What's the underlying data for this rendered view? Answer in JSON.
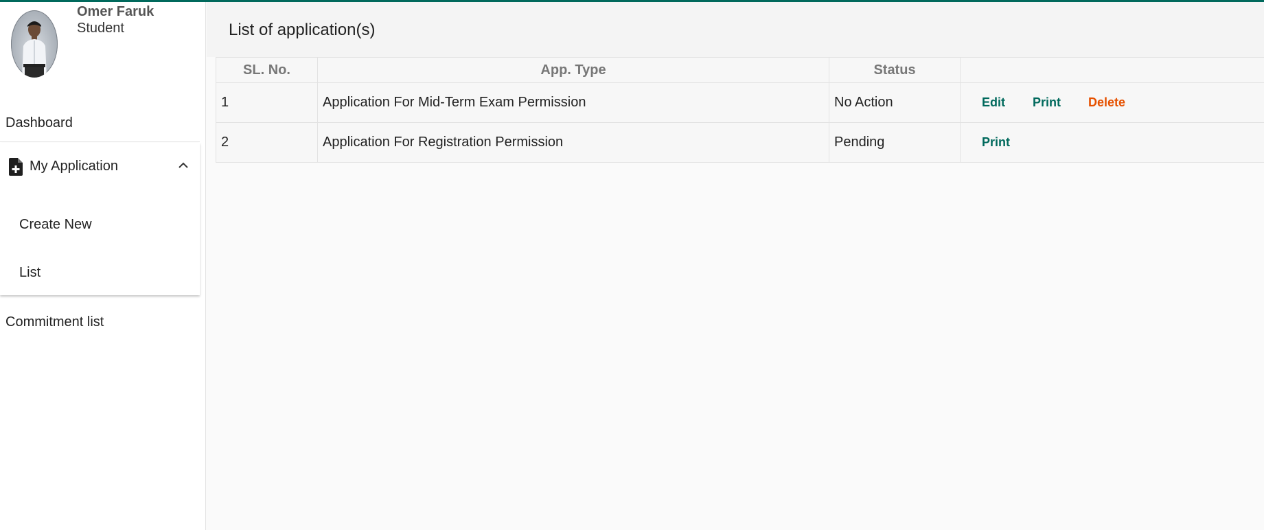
{
  "colors": {
    "accent": "#00695c",
    "danger": "#e65100"
  },
  "user": {
    "name": "Omer Faruk",
    "role": "Student"
  },
  "sidebar": {
    "dashboard": "Dashboard",
    "my_application": {
      "label": "My Application",
      "icon": "file-add-icon",
      "expanded": true,
      "children": [
        "Create New",
        "List"
      ]
    },
    "commitment": "Commitment list"
  },
  "main": {
    "title": "List of application(s)",
    "table": {
      "headers": [
        "SL. No.",
        "App. Type",
        "Status",
        ""
      ],
      "rows": [
        {
          "sl": "1",
          "type": "Application For Mid-Term Exam Permission",
          "status": "No Action",
          "actions": [
            "Edit",
            "Print",
            "Delete"
          ]
        },
        {
          "sl": "2",
          "type": "Application For Registration Permission",
          "status": "Pending",
          "actions": [
            "Print"
          ]
        }
      ]
    }
  }
}
